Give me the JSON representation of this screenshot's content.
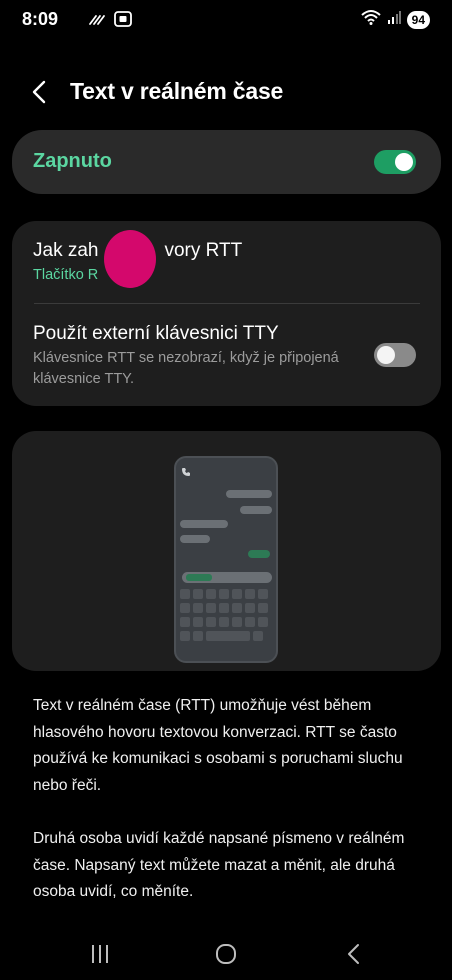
{
  "status_bar": {
    "time": "8:09",
    "battery": "94",
    "left_icons": [
      "hotspot-icon",
      "screenshot-icon"
    ],
    "right_icons": [
      "wifi-icon",
      "signal-icon"
    ]
  },
  "header": {
    "title": "Text v reálném čase",
    "back_icon": "back-arrow-icon"
  },
  "master": {
    "label": "Zapnuto",
    "enabled": true
  },
  "options": [
    {
      "title": "Jak zahájit hovory RTT",
      "title_visible": [
        "Jak zah",
        "vory RTT"
      ],
      "subtitle": "Tlačítko R"
    },
    {
      "title": "Použít externí klávesnici TTY",
      "subtitle": "Klávesnice RTT se nezobrazí, když je připojená klávesnice TTY.",
      "enabled": false
    }
  ],
  "description": {
    "paragraph1": "Text v reálném čase (RTT) umožňuje vést během hlasového hovoru textovou konverzaci. RTT se často používá ke komunikaci s osobami s poruchami sluchu nebo řeči.",
    "paragraph2": "Druhá osoba uvidí každé napsané písmeno v reálném čase. Napsaný text můžete mazat a měnit, ale druhá osoba uvidí, co měníte."
  },
  "nav_bar": {
    "icons": [
      "recents-icon",
      "home-icon",
      "back-icon"
    ]
  },
  "colors": {
    "accent": "#5bd6a1",
    "toggle_on": "#1e9e63",
    "card": "#1e1e1e",
    "touch_indicator": "#d4086c"
  }
}
